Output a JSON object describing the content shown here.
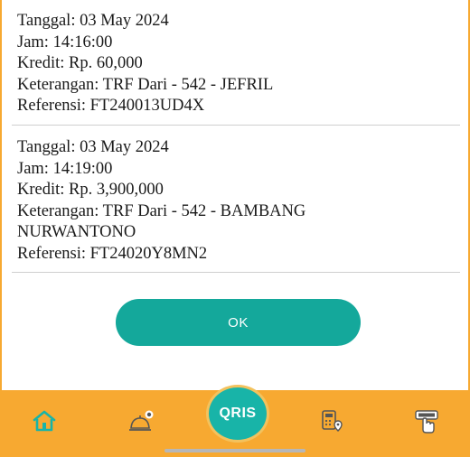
{
  "transactions": [
    {
      "tanggal": "Tanggal: 03 May 2024",
      "jam": "Jam: 14:16:00",
      "kredit": "Kredit: Rp. 60,000",
      "keterangan_line1": "Keterangan: TRF Dari - 542 - JEFRIL",
      "keterangan_line2": "",
      "referensi": "Referensi: FT240013UD4X"
    },
    {
      "tanggal": "Tanggal: 03 May 2024",
      "jam": "Jam: 14:19:00",
      "kredit": "Kredit: Rp. 3,900,000",
      "keterangan_line1": "Keterangan: TRF Dari - 542 - BAMBANG",
      "keterangan_line2": "NURWANTONO",
      "referensi": "Referensi: FT24020Y8MN2"
    }
  ],
  "ok_button": {
    "label": "OK"
  },
  "bottom_nav": {
    "center_label": "QRIS",
    "icons": [
      "home-icon",
      "service-bell-icon",
      "qris-icon",
      "calculator-pin-icon",
      "atm-icon"
    ]
  },
  "colors": {
    "accent": "#f7a931",
    "button": "#14a89b",
    "nav_icon": "#18b4a8"
  }
}
